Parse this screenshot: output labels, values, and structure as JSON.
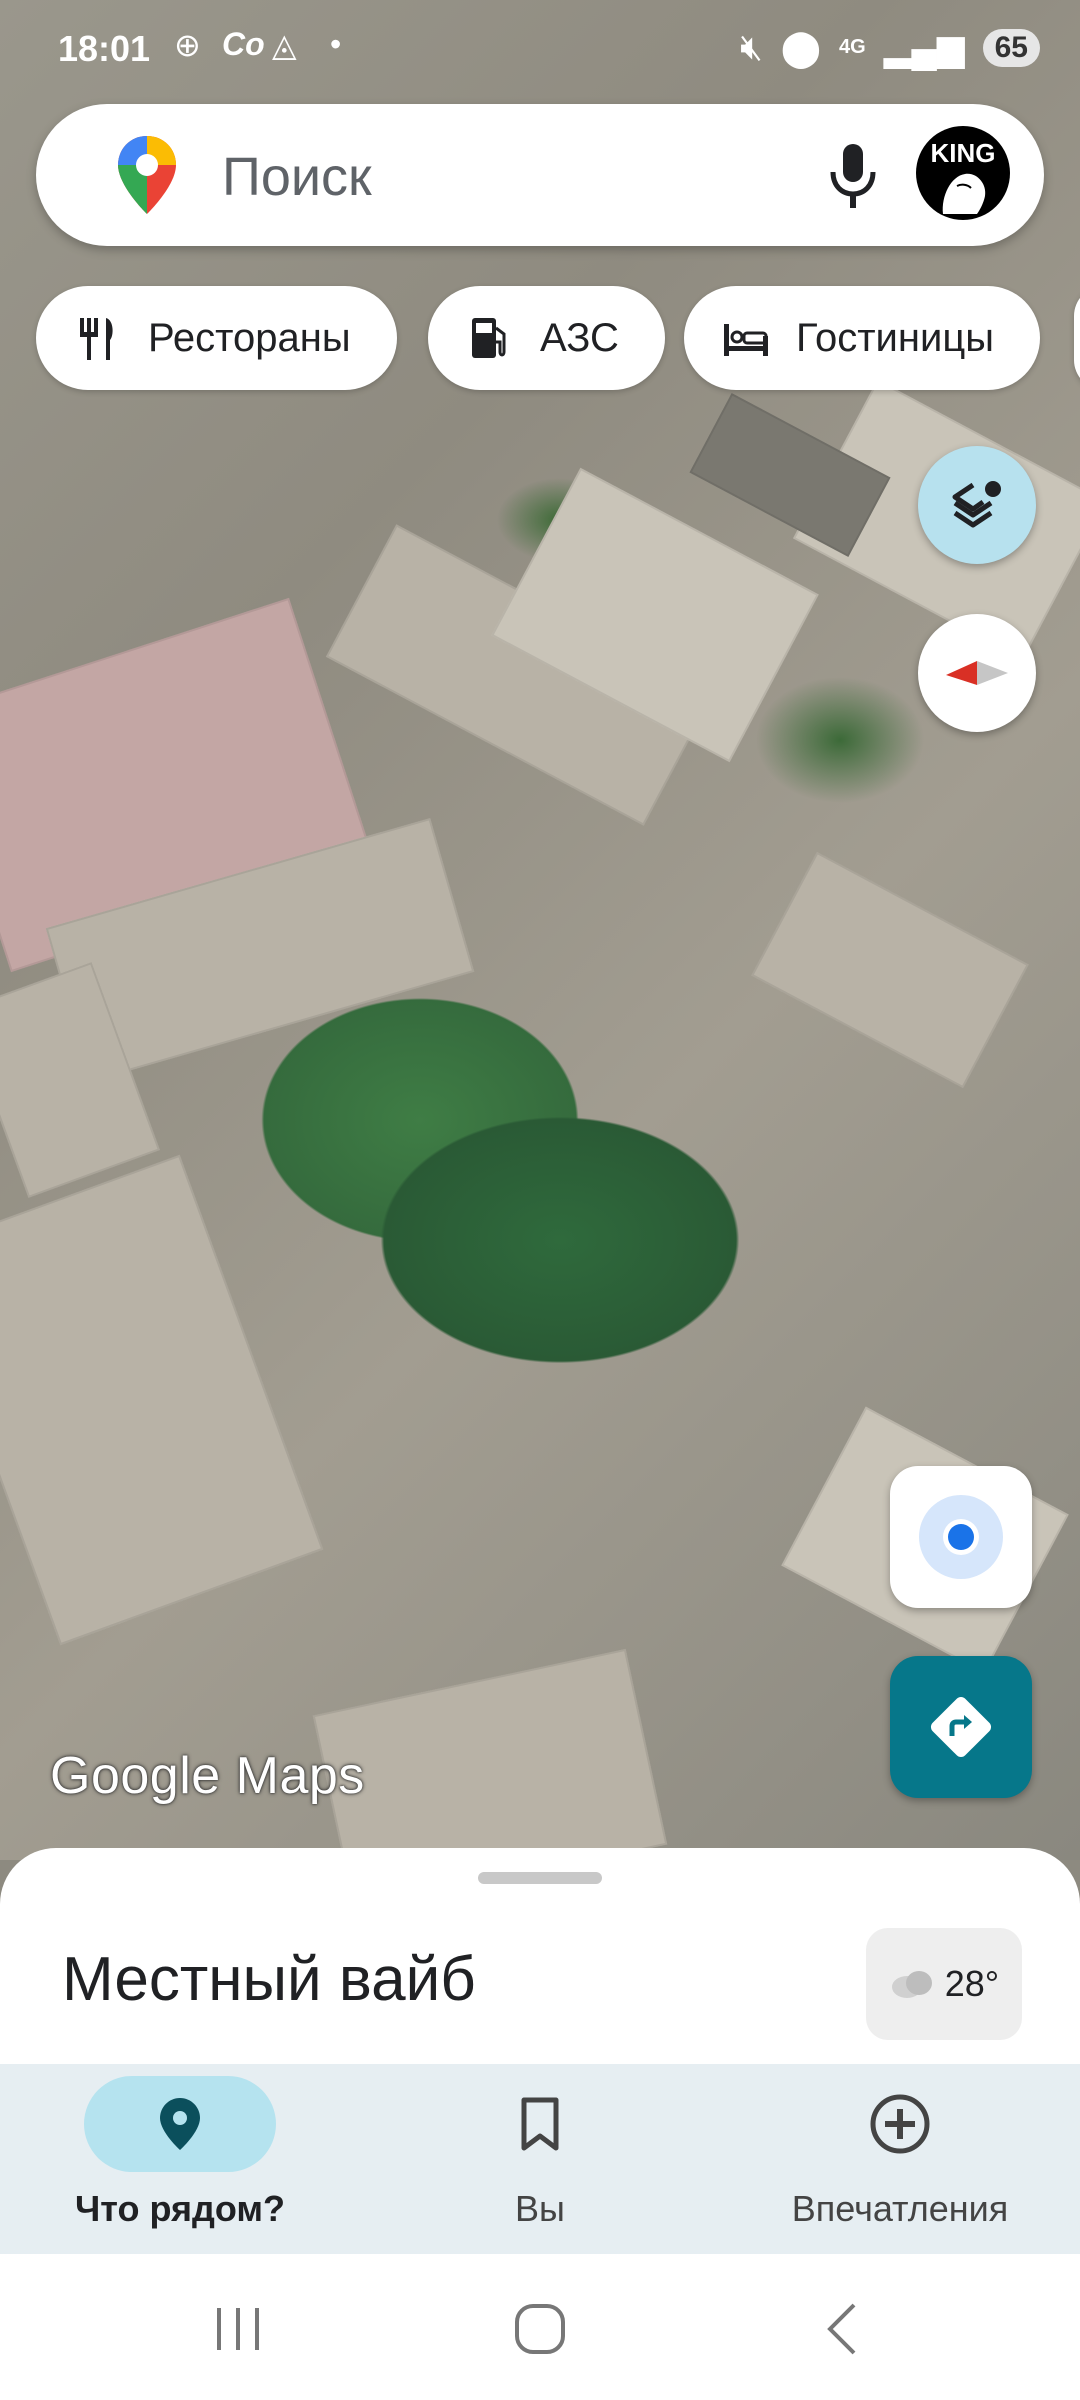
{
  "status_bar": {
    "time": "18:01",
    "network": "4G",
    "battery": "65",
    "icons": [
      "plus-circle-icon",
      "cloud-sync-icon",
      "alert-icon",
      "dot-icon",
      "mute-icon",
      "location-icon",
      "signal-icon"
    ]
  },
  "search": {
    "placeholder": "Поиск",
    "icons": [
      "maps-pin-icon",
      "microphone-icon"
    ],
    "avatar_text": "KING"
  },
  "chips": [
    {
      "label": "Рестораны",
      "icon": "restaurant-icon"
    },
    {
      "label": "АЗС",
      "icon": "gas-station-icon"
    },
    {
      "label": "Гостиницы",
      "icon": "hotel-icon"
    }
  ],
  "map": {
    "logo_text": "Google Maps",
    "buttons": [
      "layers-icon",
      "compass-icon",
      "my-location-icon",
      "directions-icon"
    ]
  },
  "sheet": {
    "title": "Местный вайб",
    "weather": "28°",
    "weather_icon": "cloud-icon"
  },
  "nav": {
    "items": [
      {
        "label": "Что рядом?",
        "icon": "place-icon",
        "active": true
      },
      {
        "label": "Вы",
        "icon": "bookmark-icon",
        "active": false
      },
      {
        "label": "Впечатления",
        "icon": "add-circle-icon",
        "active": false
      }
    ]
  },
  "colors": {
    "accent_teal": "#06778a",
    "active_pill": "#b5e3ef",
    "layers_button": "#b7e1ee",
    "compass_red": "#d93025"
  }
}
